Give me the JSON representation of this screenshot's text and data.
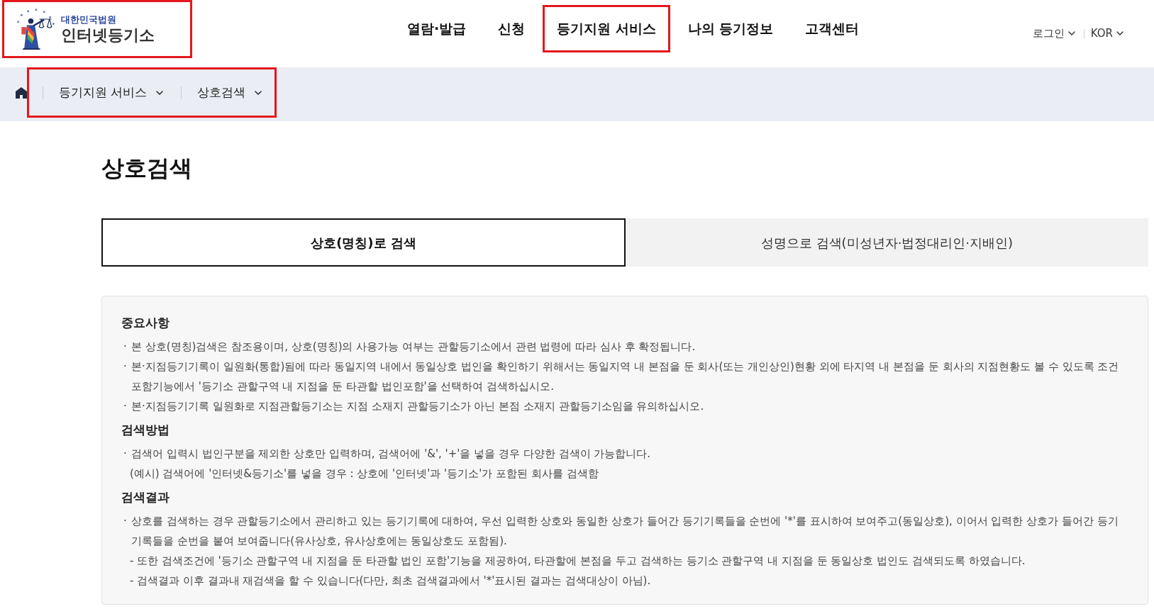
{
  "header": {
    "logo": {
      "subtitle": "대한민국법원",
      "title": "인터넷등기소",
      "highlighted": true
    },
    "nav": [
      {
        "label": "열람·발급",
        "highlighted": false
      },
      {
        "label": "신청",
        "highlighted": false
      },
      {
        "label": "등기지원 서비스",
        "highlighted": true
      },
      {
        "label": "나의 등기정보",
        "highlighted": false
      },
      {
        "label": "고객센터",
        "highlighted": false
      }
    ],
    "utility": [
      {
        "label": "로그인"
      },
      {
        "label": "KOR"
      }
    ]
  },
  "breadcrumb": {
    "highlighted": true,
    "items": [
      {
        "label": "등기지원 서비스"
      },
      {
        "label": "상호검색"
      }
    ]
  },
  "page_title": "상호검색",
  "tabs": [
    {
      "label": "상호(명칭)로 검색",
      "selected": true
    },
    {
      "label": "성명으로 검색(미성년자·법정대리인·지배인)",
      "selected": false
    }
  ],
  "notice": {
    "sections": [
      {
        "heading": "중요사항",
        "items": [
          {
            "kind": "bullet",
            "marker": "·",
            "text": "본 상호(명칭)검색은 참조용이며, 상호(명칭)의 사용가능 여부는 관할등기소에서 관련 법령에 따라 심사 후 확정됩니다."
          },
          {
            "kind": "bullet",
            "marker": "·",
            "text": "본·지점등기기록이 일원화(통합)됨에 따라 동일지역 내에서 동일상호 법인을 확인하기 위해서는 동일지역 내 본점을 둔 회사(또는 개인상인)현황 외에 타지역 내 본점을 둔 회사의 지점현황도 볼 수 있도록 조건포함기능에서 '등기소 관할구역 내 지점을 둔 타관할 법인포함'을 선택하여 검색하십시오."
          },
          {
            "kind": "bullet",
            "marker": "·",
            "text": "본·지점등기기록 일원화로 지점관할등기소는 지점 소재지 관할등기소가 아닌 본점 소재지 관할등기소임을 유의하십시오."
          }
        ]
      },
      {
        "heading": "검색방법",
        "items": [
          {
            "kind": "bullet",
            "marker": "·",
            "text": "검색어 입력시 법인구분을 제외한 상호만 입력하며, 검색어에 '&', '+'을 넣을 경우 다양한 검색이 가능합니다."
          },
          {
            "kind": "note",
            "text": "(예시) 검색어에 '인터넷&등기소'를 넣을 경우 : 상호에 '인터넷'과 '등기소'가 포함된 회사를 검색함"
          }
        ]
      },
      {
        "heading": "검색결과",
        "items": [
          {
            "kind": "bullet",
            "marker": "·",
            "text": "상호를 검색하는 경우 관할등기소에서 관리하고 있는 등기기록에 대하여, 우선 입력한 상호와 동일한 상호가 들어간 등기기록들을 순번에 '*'를 표시하여 보여주고(동일상호), 이어서 입력한 상호가 들어간 등기기록들을 순번을 붙여 보여줍니다(유사상호, 유사상호에는 동일상호도 포함됨)."
          },
          {
            "kind": "dash",
            "marker": "-",
            "text": "또한 검색조건에 '등기소 관할구역 내 지점을 둔 타관할 법인 포함'기능을 제공하여, 타관할에 본점을 두고 검색하는 등기소 관할구역 내 지점을 둔 동일상호 법인도 검색되도록 하였습니다."
          },
          {
            "kind": "dash",
            "marker": "-",
            "text": "검색결과 이후 결과내 재검색을 할 수 있습니다(다만, 최초 검색결과에서 '*'표시된 결과는 검색대상이 아님)."
          }
        ]
      }
    ]
  }
}
